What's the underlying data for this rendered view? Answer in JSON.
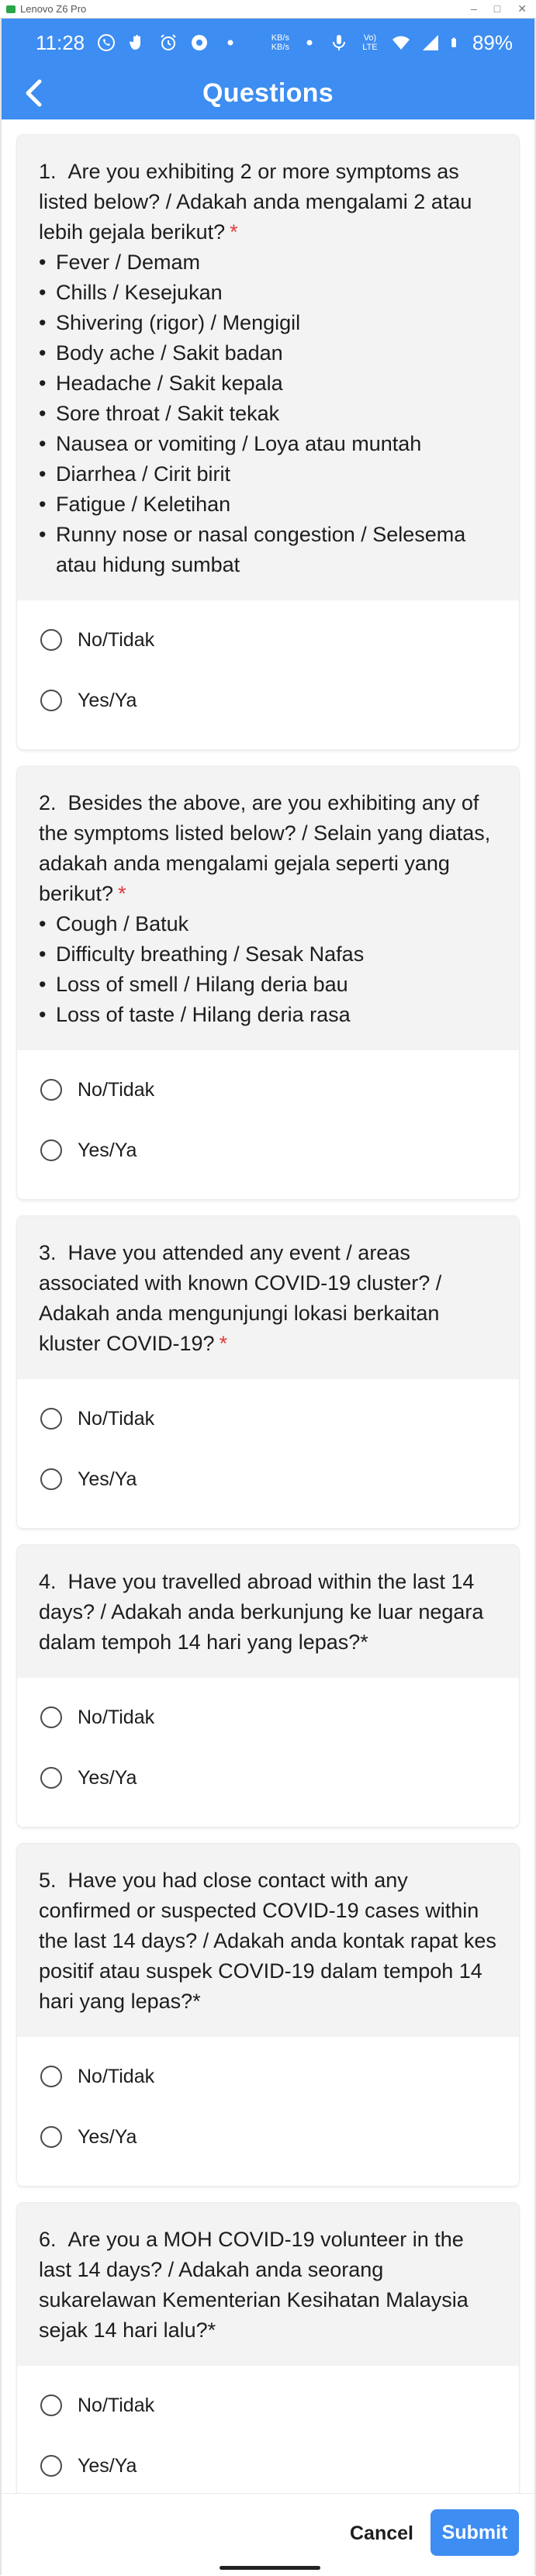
{
  "window": {
    "title": "Lenovo Z6 Pro"
  },
  "status_bar": {
    "time": "11:28",
    "net_speed_top": "KB/s",
    "net_speed_bottom": "KB/s",
    "volte": "Vo) LTE",
    "battery": "89%"
  },
  "header": {
    "title": "Questions"
  },
  "questions": [
    {
      "number": "1.",
      "text": "Are you exhibiting 2 or more symptoms as listed below? / Adakah anda mengalami 2 atau lebih gejala berikut?",
      "required_mark": "*",
      "bullets": [
        "Fever / Demam",
        "Chills / Kesejukan",
        "Shivering (rigor) / Mengigil",
        "Body ache / Sakit badan",
        "Headache / Sakit kepala",
        "Sore throat / Sakit tekak",
        "Nausea or vomiting / Loya atau muntah",
        "Diarrhea / Cirit birit",
        "Fatigue / Keletihan",
        "Runny nose or nasal congestion / Selesema atau hidung sumbat"
      ],
      "options": [
        "No/Tidak",
        "Yes/Ya"
      ]
    },
    {
      "number": "2.",
      "text": "Besides the above, are you exhibiting any of the symptoms listed below? / Selain yang diatas, adakah anda mengalami gejala seperti yang berikut?",
      "required_mark": "*",
      "bullets": [
        "Cough / Batuk",
        "Difficulty breathing / Sesak Nafas",
        "Loss of smell / Hilang deria bau",
        "Loss of taste / Hilang deria rasa"
      ],
      "options": [
        "No/Tidak",
        "Yes/Ya"
      ]
    },
    {
      "number": "3.",
      "text": "Have you attended any event / areas associated with known COVID-19 cluster? / Adakah anda mengunjungi lokasi berkaitan kluster COVID-19?",
      "required_mark": "*",
      "bullets": [],
      "options": [
        "No/Tidak",
        "Yes/Ya"
      ]
    },
    {
      "number": "4.",
      "text": "Have you travelled abroad within the last 14 days? / Adakah anda berkunjung ke luar negara dalam tempoh 14 hari yang lepas?*",
      "required_mark": "",
      "bullets": [],
      "options": [
        "No/Tidak",
        "Yes/Ya"
      ]
    },
    {
      "number": "5.",
      "text": "Have you had close contact with any confirmed or suspected COVID-19 cases within the last 14 days? / Adakah anda kontak rapat kes positif atau suspek COVID-19 dalam tempoh 14 hari yang lepas?*",
      "required_mark": "",
      "bullets": [],
      "options": [
        "No/Tidak",
        "Yes/Ya"
      ]
    },
    {
      "number": "6.",
      "text": "Are you a MOH COVID-19 volunteer in the last 14 days? / Adakah anda seorang sukarelawan Kementerian Kesihatan Malaysia sejak 14 hari lalu?*",
      "required_mark": "",
      "bullets": [],
      "options": [
        "No/Tidak",
        "Yes/Ya"
      ]
    }
  ],
  "footer": {
    "cancel_label": "Cancel",
    "submit_label": "Submit"
  },
  "colors": {
    "primary": "#3d8df2",
    "required": "#e23b3b",
    "question_bg": "#f3f3f3"
  }
}
